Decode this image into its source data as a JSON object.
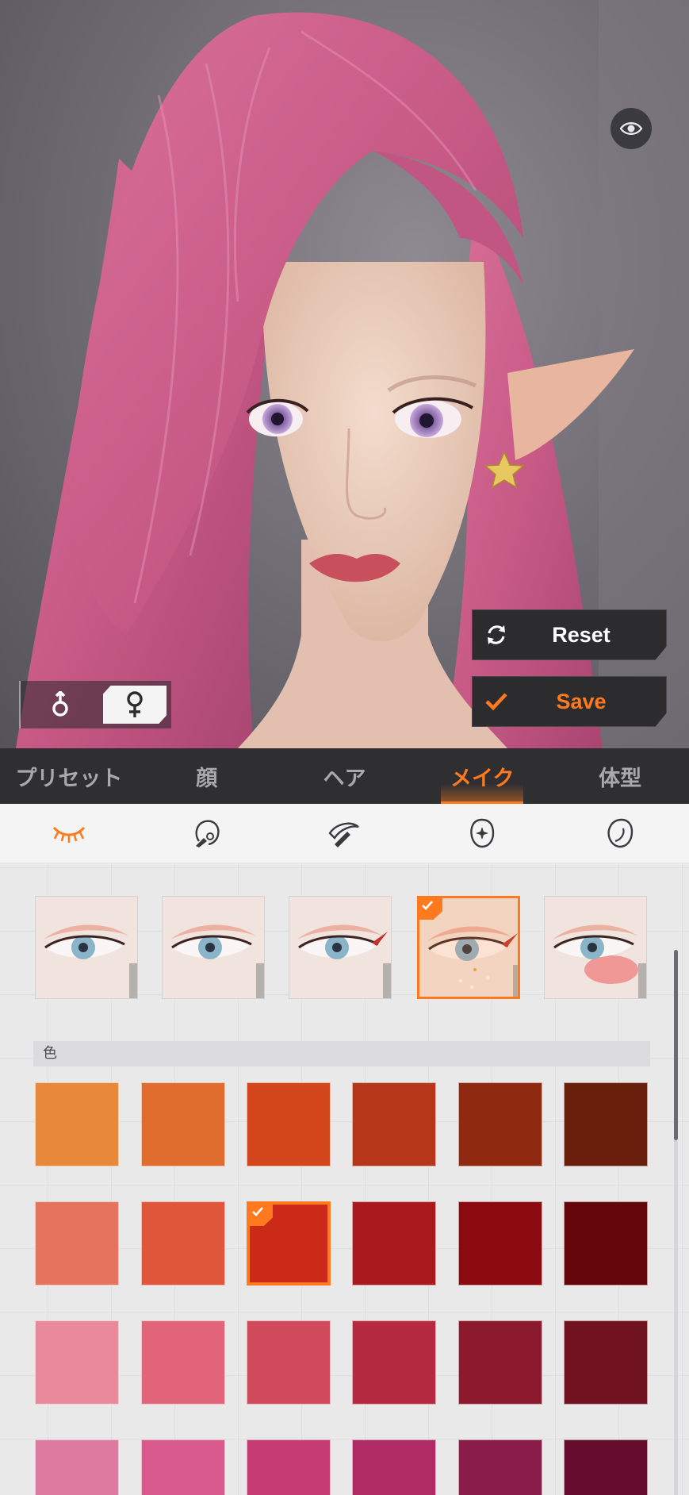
{
  "viewport": {
    "eye_icon": "eye-icon",
    "reset_label": "Reset",
    "save_label": "Save",
    "male_symbol": "♂",
    "female_symbol": "♀"
  },
  "category_tabs": [
    {
      "label": "プリセット",
      "active": false
    },
    {
      "label": "顔",
      "active": false
    },
    {
      "label": "ヘア",
      "active": false
    },
    {
      "label": "メイク",
      "active": true
    },
    {
      "label": "体型",
      "active": false
    }
  ],
  "sub_tabs": [
    {
      "icon": "eyelash-icon",
      "active": true
    },
    {
      "icon": "lips-brush-icon",
      "active": false
    },
    {
      "icon": "eyebrow-brush-icon",
      "active": false
    },
    {
      "icon": "sparkle-face-icon",
      "active": false
    },
    {
      "icon": "face-outline-icon",
      "active": false
    }
  ],
  "styles": [
    {
      "variant": "soft-red-liner",
      "selected": false
    },
    {
      "variant": "light-shadow",
      "selected": false
    },
    {
      "variant": "winged-red",
      "selected": false
    },
    {
      "variant": "winged-with-freckles",
      "selected": true
    },
    {
      "variant": "blush-cheek",
      "selected": false
    }
  ],
  "color_section_label": "色",
  "colors": [
    [
      "#e8883b",
      "#e06c2e",
      "#d4461b",
      "#b53618",
      "#8f2a10",
      "#6a1e0c"
    ],
    [
      "#e6735d",
      "#e0563a",
      "#cc2a18",
      "#aa1a1c",
      "#8a0a0f",
      "#640509"
    ],
    [
      "#e88a99",
      "#e26478",
      "#d04a5c",
      "#b52a40",
      "#8c1a2e",
      "#701220"
    ],
    [
      "#dc7aa0",
      "#d85a8c",
      "#c83c74",
      "#b02a64",
      "#8a1c4a",
      "#660c2c"
    ]
  ],
  "selected_color": {
    "row": 1,
    "col": 2
  },
  "accent_color": "#ff7a1f"
}
